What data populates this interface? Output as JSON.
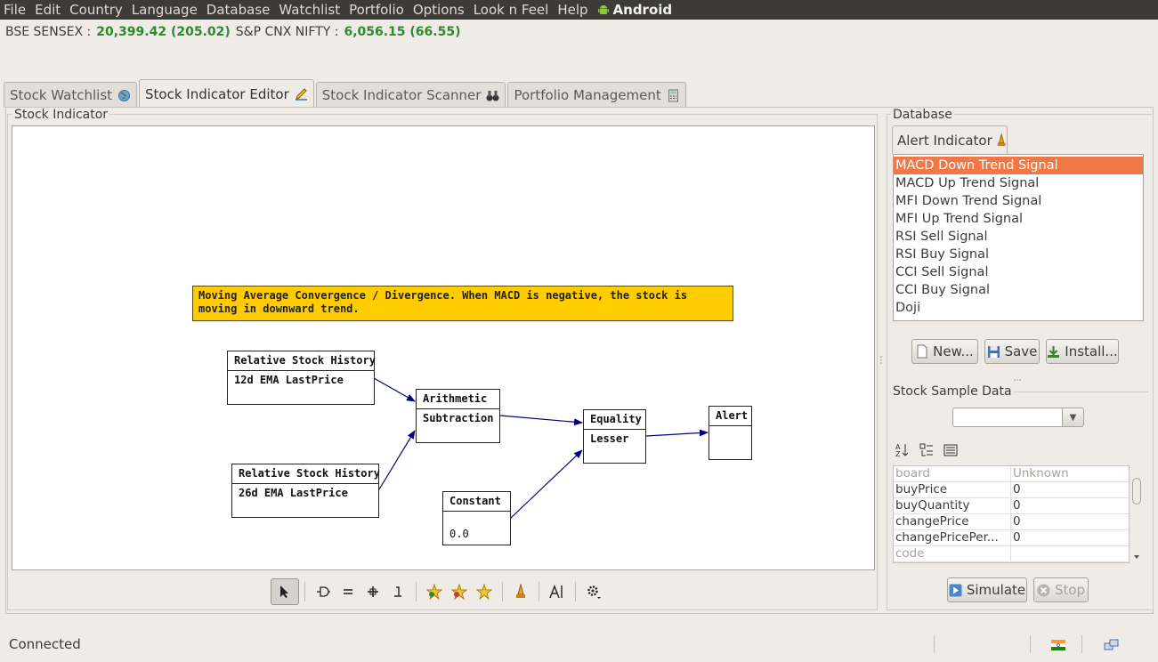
{
  "menubar": {
    "items": [
      "File",
      "Edit",
      "Country",
      "Language",
      "Database",
      "Watchlist",
      "Portfolio",
      "Options",
      "Look n Feel",
      "Help"
    ],
    "android_label": "Android"
  },
  "ticker": {
    "sensex_label": "BSE SENSEX :",
    "sensex_value": "20,399.42 (205.02)",
    "nifty_label": "S&P CNX NIFTY :",
    "nifty_value": "6,056.15 (66.55)",
    "value_color": "#2e8a2e"
  },
  "tabs": [
    {
      "label": "Stock Watchlist",
      "icon": "globe-icon",
      "active": false
    },
    {
      "label": "Stock Indicator Editor",
      "icon": "pencil-icon",
      "active": true
    },
    {
      "label": "Stock Indicator Scanner",
      "icon": "binoculars-icon",
      "active": false
    },
    {
      "label": "Portfolio Management",
      "icon": "calculator-icon",
      "active": false
    }
  ],
  "editor": {
    "group_title": "Stock Indicator",
    "note": "Moving Average Convergence / Divergence. When MACD is negative, the stock is moving in downward trend.",
    "note_color": "#ffcc00",
    "nodes": [
      {
        "id": "rsh12",
        "title": "Relative Stock History",
        "body": "12d EMA LastPrice"
      },
      {
        "id": "rsh26",
        "title": "Relative Stock History",
        "body": "26d EMA LastPrice"
      },
      {
        "id": "arith",
        "title": "Arithmetic",
        "body": "Subtraction"
      },
      {
        "id": "const",
        "title": "Constant",
        "body": "0.0"
      },
      {
        "id": "equal",
        "title": "Equality",
        "body": "Lesser"
      },
      {
        "id": "alert",
        "title": "Alert",
        "body": ""
      }
    ],
    "wire_color": "#000080"
  },
  "toolbar": {
    "tools": [
      "select-arrow-icon",
      "operator-icon",
      "equality-icon",
      "arithmetic-plus-icon",
      "constant-icon",
      "star-add-icon",
      "star-remove-icon",
      "star-icon",
      "alert-indicator-icon",
      "text-tool-icon",
      "settings-icon"
    ]
  },
  "database": {
    "group_title": "Database",
    "tab_label": "Alert Indicator",
    "items": [
      "MACD Down Trend Signal",
      "MACD Up Trend Signal",
      "MFI Down Trend Signal",
      "MFI Up Trend Signal",
      "RSI Sell Signal",
      "RSI Buy Signal",
      "CCI Sell Signal",
      "CCI Buy Signal",
      "Doji"
    ],
    "selected_index": 0,
    "selected_color": "#f07746",
    "buttons": {
      "new": "New...",
      "save": "Save",
      "install": "Install..."
    }
  },
  "sample": {
    "group_title": "Stock Sample Data",
    "combo_value": "",
    "properties": [
      {
        "key": "board",
        "value": "Unknown",
        "dim": true
      },
      {
        "key": "buyPrice",
        "value": "0",
        "dim": false
      },
      {
        "key": "buyQuantity",
        "value": "0",
        "dim": false
      },
      {
        "key": "changePrice",
        "value": "0",
        "dim": false
      },
      {
        "key": "changePricePer...",
        "value": "0",
        "dim": false
      },
      {
        "key": "code",
        "value": "",
        "dim": true
      }
    ],
    "buttons": {
      "simulate": "Simulate",
      "stop": "Stop"
    }
  },
  "status": {
    "text": "Connected"
  }
}
